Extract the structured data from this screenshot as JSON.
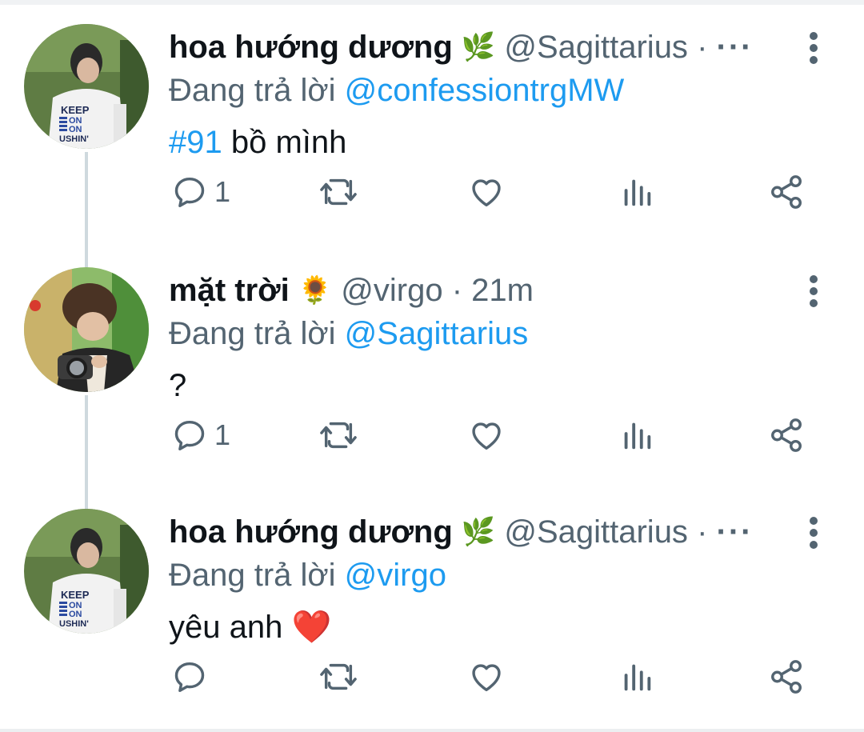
{
  "tweets": [
    {
      "display_name": "hoa hướng dương",
      "name_emoji": "🌿",
      "handle": "@Sagittarius",
      "separator": "·",
      "time": "",
      "more": "···",
      "replying_prefix": "Đang trả lời",
      "replying_to": "@confessiontrgMW",
      "body_hashtag": "#91",
      "body_text": "bồ mình",
      "reply_count": "1",
      "avatar_badge_lines": [
        "KEEP",
        "ON",
        "ON",
        "USHIN'"
      ]
    },
    {
      "display_name": "mặt trời",
      "name_emoji": "🌻",
      "handle": "@virgo",
      "separator": "·",
      "time": "21m",
      "more": "",
      "replying_prefix": "Đang trả lời",
      "replying_to": "@Sagittarius",
      "body_hashtag": "",
      "body_text": "?",
      "reply_count": "1"
    },
    {
      "display_name": "hoa hướng dương",
      "name_emoji": "🌿",
      "handle": "@Sagittarius",
      "separator": "·",
      "time": "",
      "more": "···",
      "replying_prefix": "Đang trả lời",
      "replying_to": "@virgo",
      "body_hashtag": "",
      "body_text": "yêu anh ❤️",
      "reply_count": "",
      "avatar_badge_lines": [
        "KEEP",
        "ON",
        "ON",
        "USHIN'"
      ]
    }
  ],
  "icons": {
    "reply": "reply-icon",
    "retweet": "retweet-icon",
    "like": "heart-icon",
    "views": "analytics-icon",
    "share": "share-icon",
    "overflow": "kebab-menu-icon"
  },
  "colors": {
    "text": "#0f1419",
    "secondary": "#536471",
    "link": "#1d9bf0",
    "thread_line": "#cfd9de"
  }
}
